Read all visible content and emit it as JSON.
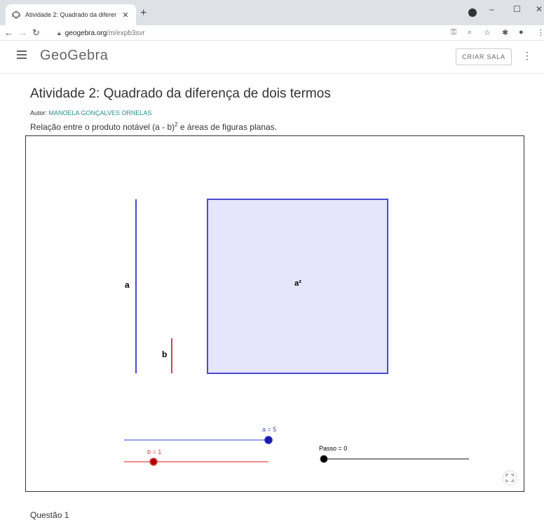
{
  "browser": {
    "tab_title": "Atividade 2: Quadrado da diferen",
    "tab_close": "✕",
    "new_tab": "+",
    "url_host": "geogebra.org",
    "url_path": "/m/expb3svr",
    "minimize": "–",
    "maximize": "☐",
    "close": "✕"
  },
  "header": {
    "logo": "GeoGebra",
    "criar_sala": "CRIAR SALA"
  },
  "page": {
    "title": "Atividade 2: Quadrado da diferença de dois termos",
    "author_label": "Autor: ",
    "author_name": "MANOELA GONÇALVES ORNELAS",
    "description_pre": "Relação entre o produto notável (a - b)",
    "description_sup": "2",
    "description_post": " e áreas de figuras planas.",
    "question": "Questão 1"
  },
  "applet": {
    "label_a": "a",
    "label_b": "b",
    "label_square": "a²",
    "slider_a_label": "a = 5",
    "slider_b_label": "b = 1",
    "slider_passo_label": "Passo = 0",
    "slider_a_value": 5,
    "slider_b_value": 1,
    "slider_passo_value": 0,
    "colors": {
      "a": "#4a4ad0",
      "b": "#d04444",
      "square_fill": "#e5e5fb",
      "square_stroke": "#4a4ad0",
      "passo": "#888888"
    }
  }
}
